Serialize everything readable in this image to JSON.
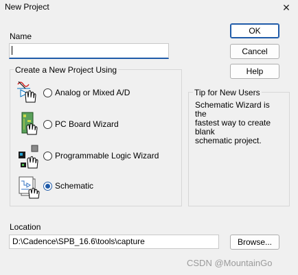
{
  "window": {
    "title": "New Project",
    "close_glyph": "✕"
  },
  "name": {
    "label": "Name",
    "value": ""
  },
  "buttons": {
    "ok": "OK",
    "cancel": "Cancel",
    "help": "Help",
    "browse": "Browse..."
  },
  "create_group": {
    "title": "Create a New Project Using",
    "options": [
      {
        "label": "Analog or Mixed A/D",
        "icon": "analog-mixed-icon",
        "checked": false
      },
      {
        "label": "PC Board Wizard",
        "icon": "pc-board-icon",
        "checked": false
      },
      {
        "label": "Programmable Logic Wizard",
        "icon": "programmable-logic-icon",
        "checked": false
      },
      {
        "label": "Schematic",
        "icon": "schematic-icon",
        "checked": true
      }
    ]
  },
  "tip": {
    "title": "Tip for New Users",
    "lines": [
      "Schematic Wizard is the",
      "fastest way to create blank",
      "schematic project."
    ]
  },
  "location": {
    "label": "Location",
    "value": "D:\\Cadence\\SPB_16.6\\tools\\capture"
  },
  "watermark": "CSDN @MountainGo",
  "colors": {
    "accent": "#1e5aa8",
    "background": "#f0f0f0"
  }
}
